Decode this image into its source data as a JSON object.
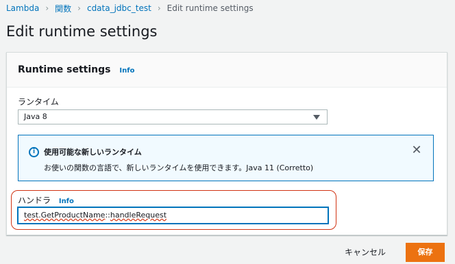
{
  "breadcrumb": {
    "items": [
      "Lambda",
      "関数",
      "cdata_jdbc_test",
      "Edit runtime settings"
    ]
  },
  "page": {
    "title": "Edit runtime settings"
  },
  "panel": {
    "title": "Runtime settings",
    "info": "Info",
    "runtime": {
      "label": "ランタイム",
      "value": "Java 8"
    },
    "alert": {
      "title": "使用可能な新しいランタイム",
      "body": "お使いの関数の言語で、新しいランタイムを使用できます。Java 11 (Corretto)",
      "icon": "info-icon"
    },
    "handler": {
      "label": "ハンドラ",
      "info": "Info",
      "value_part1": "test.GetProductName",
      "value_sep": "::",
      "value_part2": "handleRequest"
    }
  },
  "actions": {
    "cancel": "キャンセル",
    "save": "保存"
  },
  "colors": {
    "accent": "#0073bb",
    "primary": "#ec7211",
    "annotation": "#d13212"
  }
}
